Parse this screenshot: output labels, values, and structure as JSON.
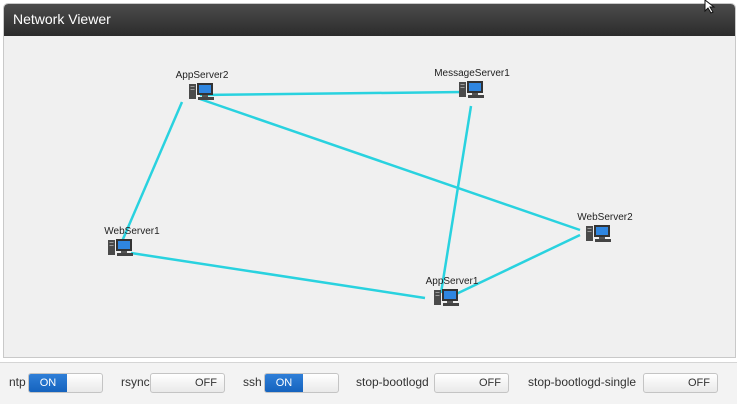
{
  "window": {
    "title": "Network Viewer"
  },
  "network": {
    "edge_color": "#29d2df",
    "nodes": [
      {
        "id": "appserver2",
        "label": "AppServer2"
      },
      {
        "id": "messageserver1",
        "label": "MessageServer1"
      },
      {
        "id": "webserver1",
        "label": "WebServer1"
      },
      {
        "id": "webserver2",
        "label": "WebServer2"
      },
      {
        "id": "appserver1",
        "label": "AppServer1"
      }
    ],
    "edges": [
      [
        "appserver2",
        "messageserver1"
      ],
      [
        "appserver2",
        "webserver1"
      ],
      [
        "appserver2",
        "webserver2"
      ],
      [
        "messageserver1",
        "appserver1"
      ],
      [
        "webserver1",
        "appserver1"
      ],
      [
        "webserver2",
        "appserver1"
      ]
    ]
  },
  "services": [
    {
      "name": "ntp",
      "state": "ON"
    },
    {
      "name": "rsync",
      "state": "OFF"
    },
    {
      "name": "ssh",
      "state": "ON"
    },
    {
      "name": "stop-bootlogd",
      "state": "OFF"
    },
    {
      "name": "stop-bootlogd-single",
      "state": "OFF"
    }
  ],
  "colors": {
    "toggle_on": "#1f6fcf",
    "titlebar": "#3a3a3a"
  },
  "icons": {
    "node": "server-computer-icon",
    "cursor": "mouse-pointer-icon"
  }
}
